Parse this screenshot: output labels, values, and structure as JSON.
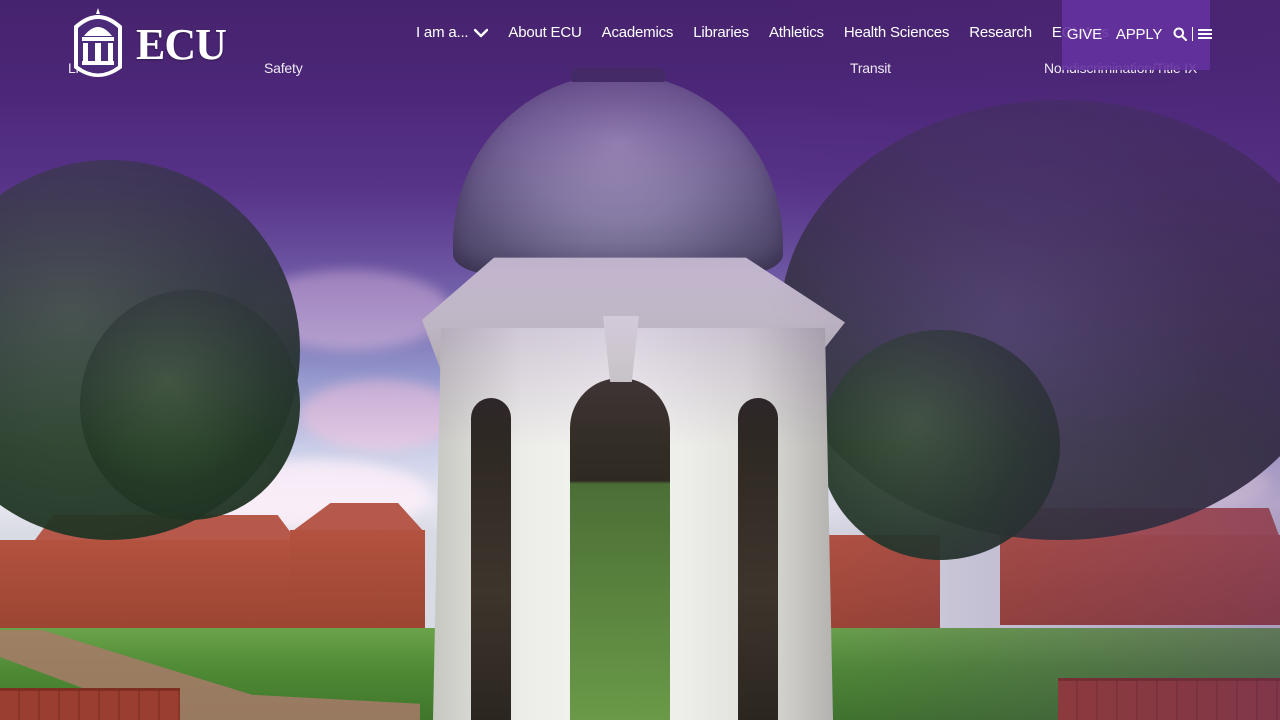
{
  "brand": {
    "name": "ECU",
    "primary_color": "#4b2a7a",
    "utility_bg_color": "#6532a0"
  },
  "nav": {
    "items": [
      {
        "label": "I am a...",
        "has_dropdown": true,
        "icon": "chevron-down-icon"
      },
      {
        "label": "About ECU"
      },
      {
        "label": "Academics"
      },
      {
        "label": "Libraries"
      },
      {
        "label": "Athletics"
      },
      {
        "label": "Health Sciences"
      },
      {
        "label": "Research"
      },
      {
        "label": "ECUArts"
      }
    ]
  },
  "utility": {
    "give_label": "GIVE",
    "apply_label": "APPLY",
    "search_icon": "search-icon",
    "menu_icon": "hamburger-menu-icon"
  },
  "dropdown_peek": {
    "items": [
      {
        "label": "Li"
      },
      {
        "label": "Safety"
      },
      {
        "label": "Transit"
      },
      {
        "label": "Nondiscrimination/Title IX"
      }
    ]
  }
}
